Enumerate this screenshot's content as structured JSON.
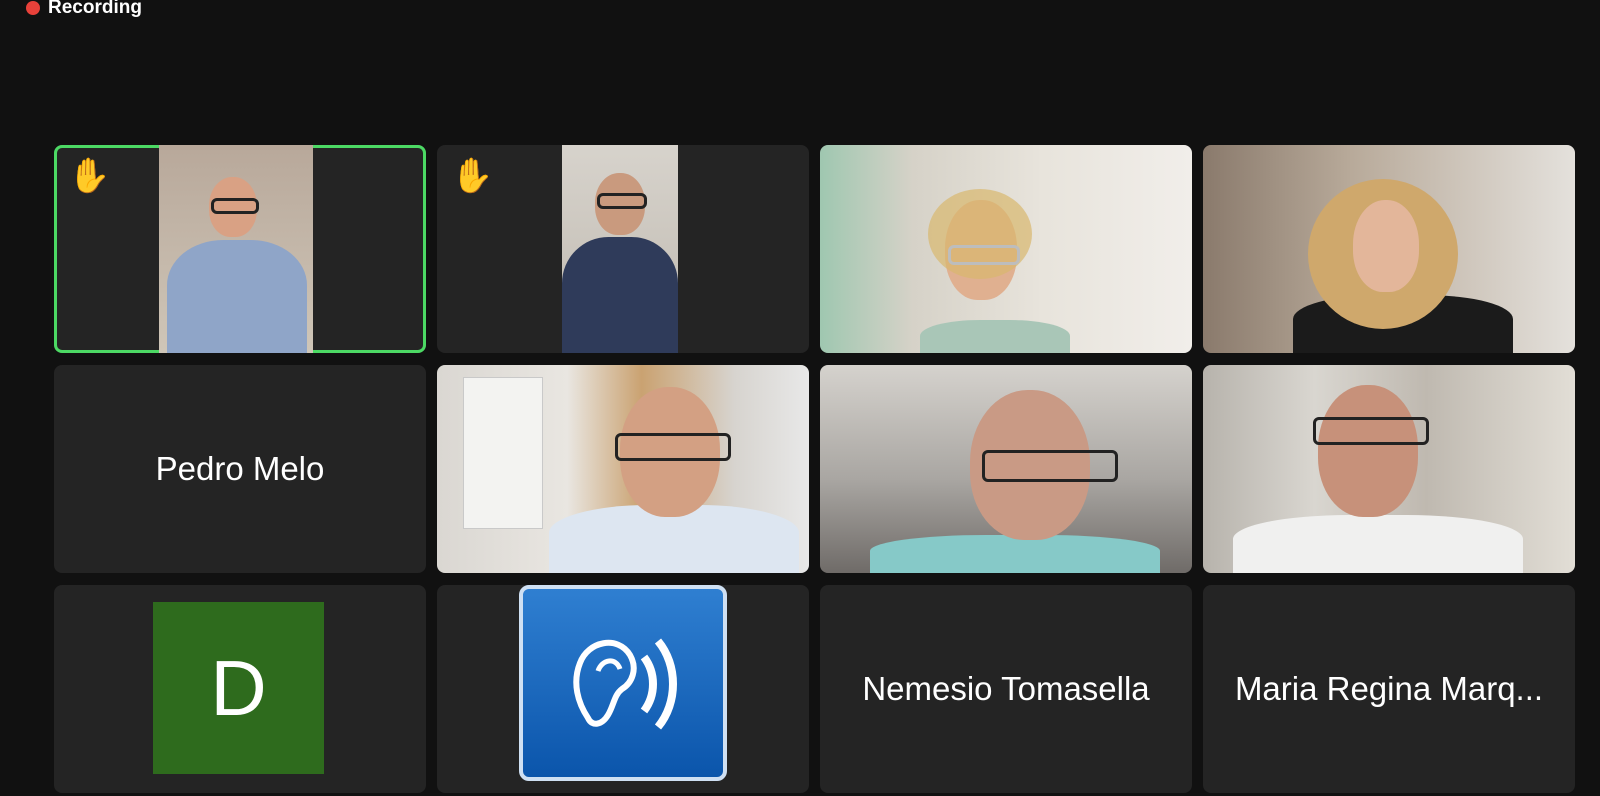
{
  "status": {
    "recording_label": "Recording",
    "recording_color": "#e8413a"
  },
  "accent": {
    "active_speaker_border": "#4cd964"
  },
  "participants": [
    {
      "kind": "video",
      "hand_raised": true,
      "hand_icon": "raised-hand-icon",
      "active_speaker": true
    },
    {
      "kind": "video",
      "hand_raised": true,
      "hand_icon": "raised-hand-icon"
    },
    {
      "kind": "video"
    },
    {
      "kind": "video"
    },
    {
      "kind": "name",
      "name": "Pedro Melo"
    },
    {
      "kind": "video"
    },
    {
      "kind": "video"
    },
    {
      "kind": "video"
    },
    {
      "kind": "avatar",
      "initial": "D",
      "avatar_color": "#2e6b1d"
    },
    {
      "kind": "image",
      "icon": "hearing-assistance-icon"
    },
    {
      "kind": "name",
      "name": "Nemesio Tomasella"
    },
    {
      "kind": "name",
      "name": "Maria Regina Marq..."
    }
  ]
}
